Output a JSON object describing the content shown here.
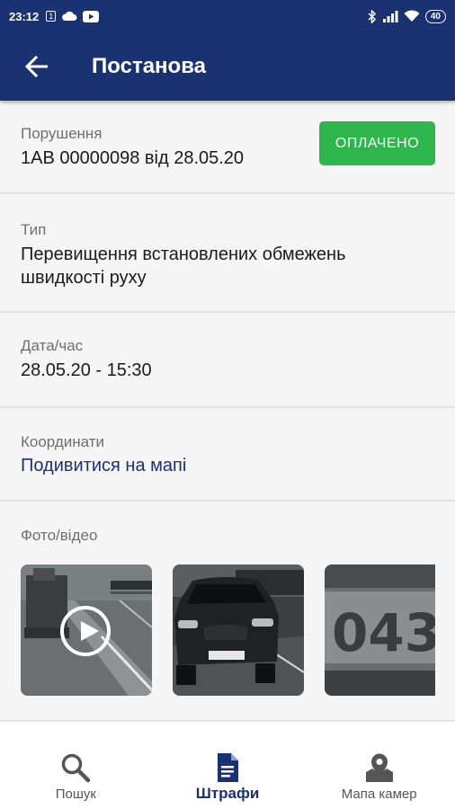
{
  "status_bar": {
    "time": "23:12",
    "notification_icons": [
      "sim-icon",
      "cloud-icon",
      "youtube-icon"
    ],
    "right_icons": [
      "bluetooth-icon",
      "signal-icon",
      "wifi-icon"
    ],
    "battery": "40"
  },
  "app_bar": {
    "title": "Постанова"
  },
  "violation": {
    "label": "Порушення",
    "value": "1АВ 00000098 від 28.05.20",
    "status": "ОПЛАЧЕНО",
    "status_color": "#2eb54c"
  },
  "type": {
    "label": "Тип",
    "value": "Перевищення встановлених обмежень швидкості руху"
  },
  "datetime": {
    "label": "Дата/час",
    "value": "28.05.20 - 15:30"
  },
  "coordinates": {
    "label": "Координати",
    "link": "Подивитися на мапі"
  },
  "media": {
    "label": "Фото/відео",
    "items": [
      {
        "kind": "video",
        "desc": "road-video"
      },
      {
        "kind": "photo",
        "desc": "car-photo"
      },
      {
        "kind": "photo",
        "desc": "plate-photo",
        "plate_text": "043"
      }
    ]
  },
  "bottom_nav": {
    "items": [
      {
        "label": "Пошук",
        "icon": "search-icon",
        "active": false
      },
      {
        "label": "Штрафи",
        "icon": "document-icon",
        "active": true
      },
      {
        "label": "Мапа камер",
        "icon": "map-pin-icon",
        "active": false
      }
    ]
  },
  "colors": {
    "primary": "#1a3272",
    "accent_green": "#2eb54c"
  }
}
